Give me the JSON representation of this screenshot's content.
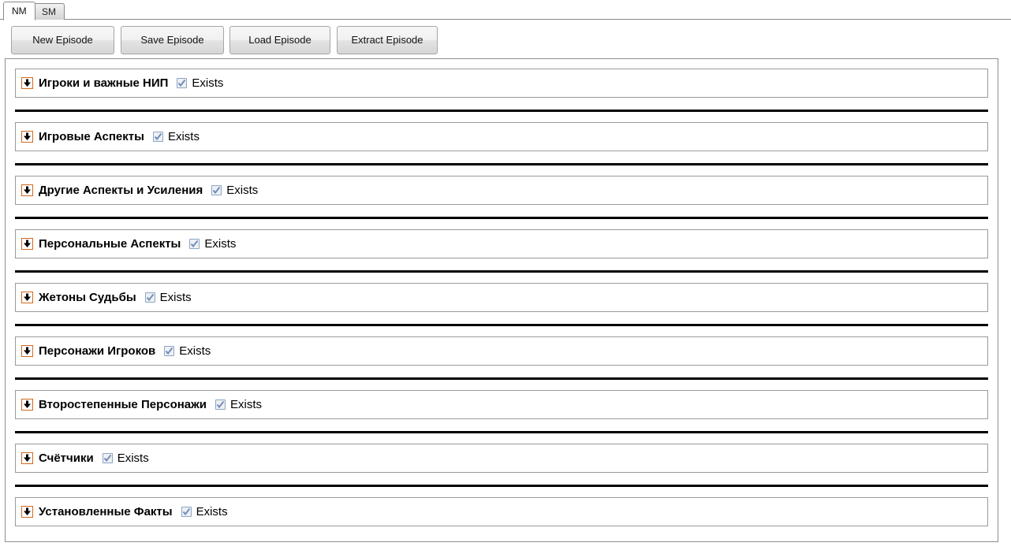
{
  "window": {
    "tabs": [
      {
        "label": "NM",
        "active": true
      },
      {
        "label": "SM",
        "active": false
      }
    ]
  },
  "toolbar": {
    "buttons": [
      {
        "label": "New Episode"
      },
      {
        "label": "Save Episode"
      },
      {
        "label": "Load Episode"
      },
      {
        "label": "Extract Episode"
      }
    ]
  },
  "icons": {
    "expander": "chevron-down-icon",
    "checkbox": "checkbox-checked-icon"
  },
  "main": {
    "checkbox_label": "Exists",
    "sections": [
      {
        "title": "Игроки и важные НИП",
        "exists": true,
        "expanded": true
      },
      {
        "title": "Игровые Аспекты",
        "exists": true,
        "expanded": true
      },
      {
        "title": "Другие Аспекты и Усиления",
        "exists": true,
        "expanded": true
      },
      {
        "title": "Персональные Аспекты",
        "exists": true,
        "expanded": true
      },
      {
        "title": "Жетоны Судьбы",
        "exists": true,
        "expanded": true
      },
      {
        "title": "Персонажи Игроков",
        "exists": true,
        "expanded": true
      },
      {
        "title": "Второстепенные Персонажи",
        "exists": true,
        "expanded": true
      },
      {
        "title": "Счётчики",
        "exists": true,
        "expanded": true
      },
      {
        "title": "Установленные Факты",
        "exists": true,
        "expanded": true
      }
    ]
  },
  "colors": {
    "expander_border": "#d2691e",
    "divider": "#000000",
    "section_border": "#9a9a9a",
    "panel_border": "#8f8f8f",
    "checkbox_border": "#8aa6c8",
    "checkbox_check": "#6f8fc0",
    "background": "#ffffff"
  }
}
